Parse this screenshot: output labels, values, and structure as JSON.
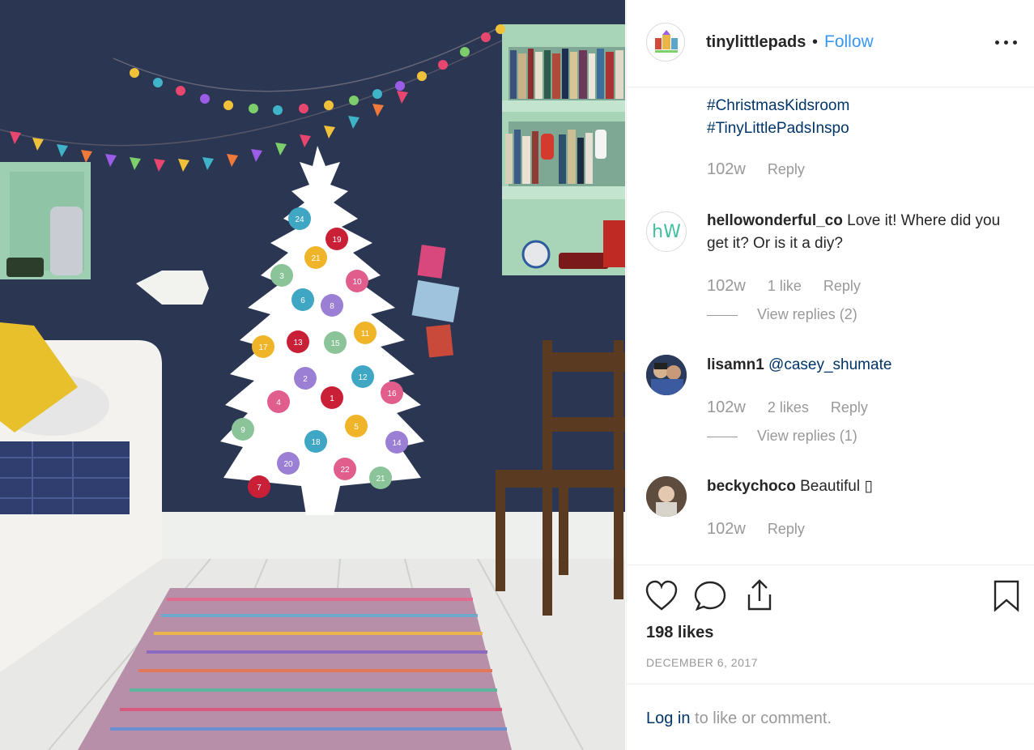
{
  "post": {
    "username": "tinylittlepads",
    "separator": "•",
    "follow_label": "Follow",
    "more_label": "more-options"
  },
  "caption": {
    "hashtag1": "#ChristmasKidsroom",
    "hashtag2": "#TinyLittlePadsInspo",
    "time": "102w",
    "reply": "Reply"
  },
  "comments": [
    {
      "username": "hellowonderful_co",
      "text": "Love it! Where did you get it? Or is it a diy?",
      "time": "102w",
      "likes": "1 like",
      "reply": "Reply",
      "view_replies": "View replies (2)",
      "avatar_text": "hW"
    },
    {
      "username": "lisamn1",
      "text": "@casey_shumate",
      "time": "102w",
      "likes": "2 likes",
      "reply": "Reply",
      "view_replies": "View replies (1)"
    },
    {
      "username": "beckychoco",
      "text": "Beautiful ▯",
      "time": "102w",
      "reply": "Reply"
    }
  ],
  "footer": {
    "likes": "198 likes",
    "date": "DECEMBER 6, 2017",
    "login_link": "Log in",
    "login_rest": " to like or comment."
  },
  "ornaments": [
    "24",
    "19",
    "21",
    "3",
    "10",
    "6",
    "8",
    "17",
    "13",
    "15",
    "11",
    "2",
    "12",
    "4",
    "1",
    "16",
    "9",
    "5",
    "18",
    "14",
    "20",
    "22",
    "21",
    "7"
  ],
  "colors": {
    "link": "#3897f0",
    "hashtag": "#003569",
    "muted": "#999999",
    "wall": "#2a3550",
    "shelf": "#a8d5b8"
  }
}
